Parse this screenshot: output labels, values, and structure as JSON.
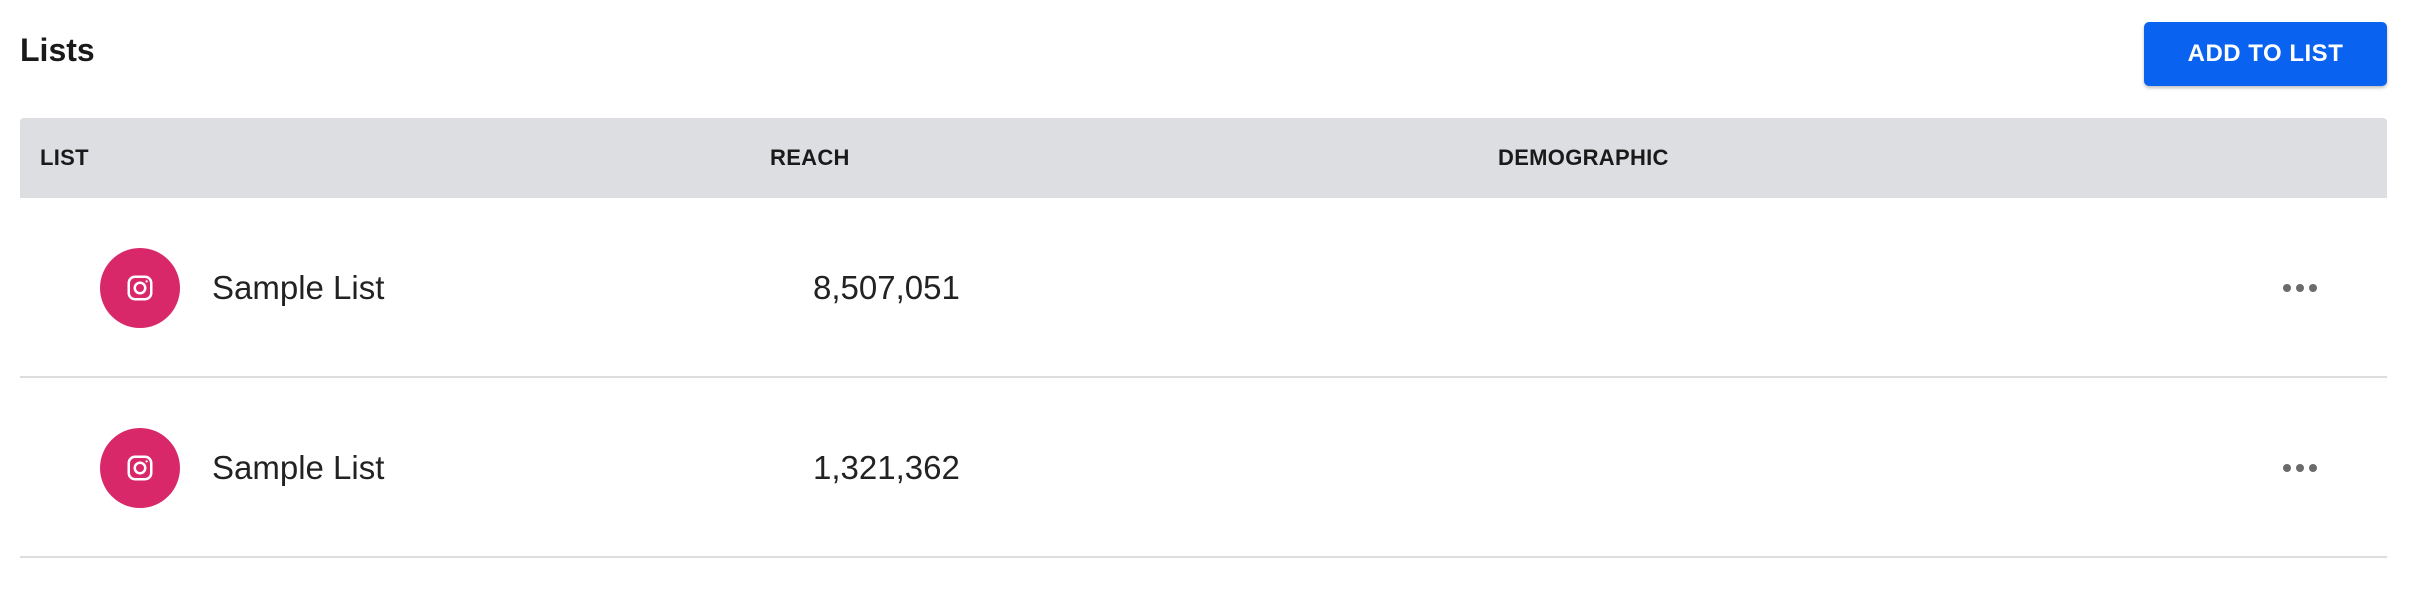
{
  "header": {
    "title": "Lists",
    "add_button_label": "ADD TO LIST"
  },
  "colors": {
    "primary": "#0a62f0",
    "instagram": "#d9286a",
    "table_header_bg": "#dcdee2"
  },
  "table": {
    "columns": [
      "LIST",
      "REACH",
      "DEMOGRAPHIC"
    ],
    "rows": [
      {
        "icon": "instagram-icon",
        "name": "Sample List",
        "reach": "8,507,051",
        "demographic": ""
      },
      {
        "icon": "instagram-icon",
        "name": "Sample List",
        "reach": "1,321,362",
        "demographic": ""
      }
    ]
  }
}
